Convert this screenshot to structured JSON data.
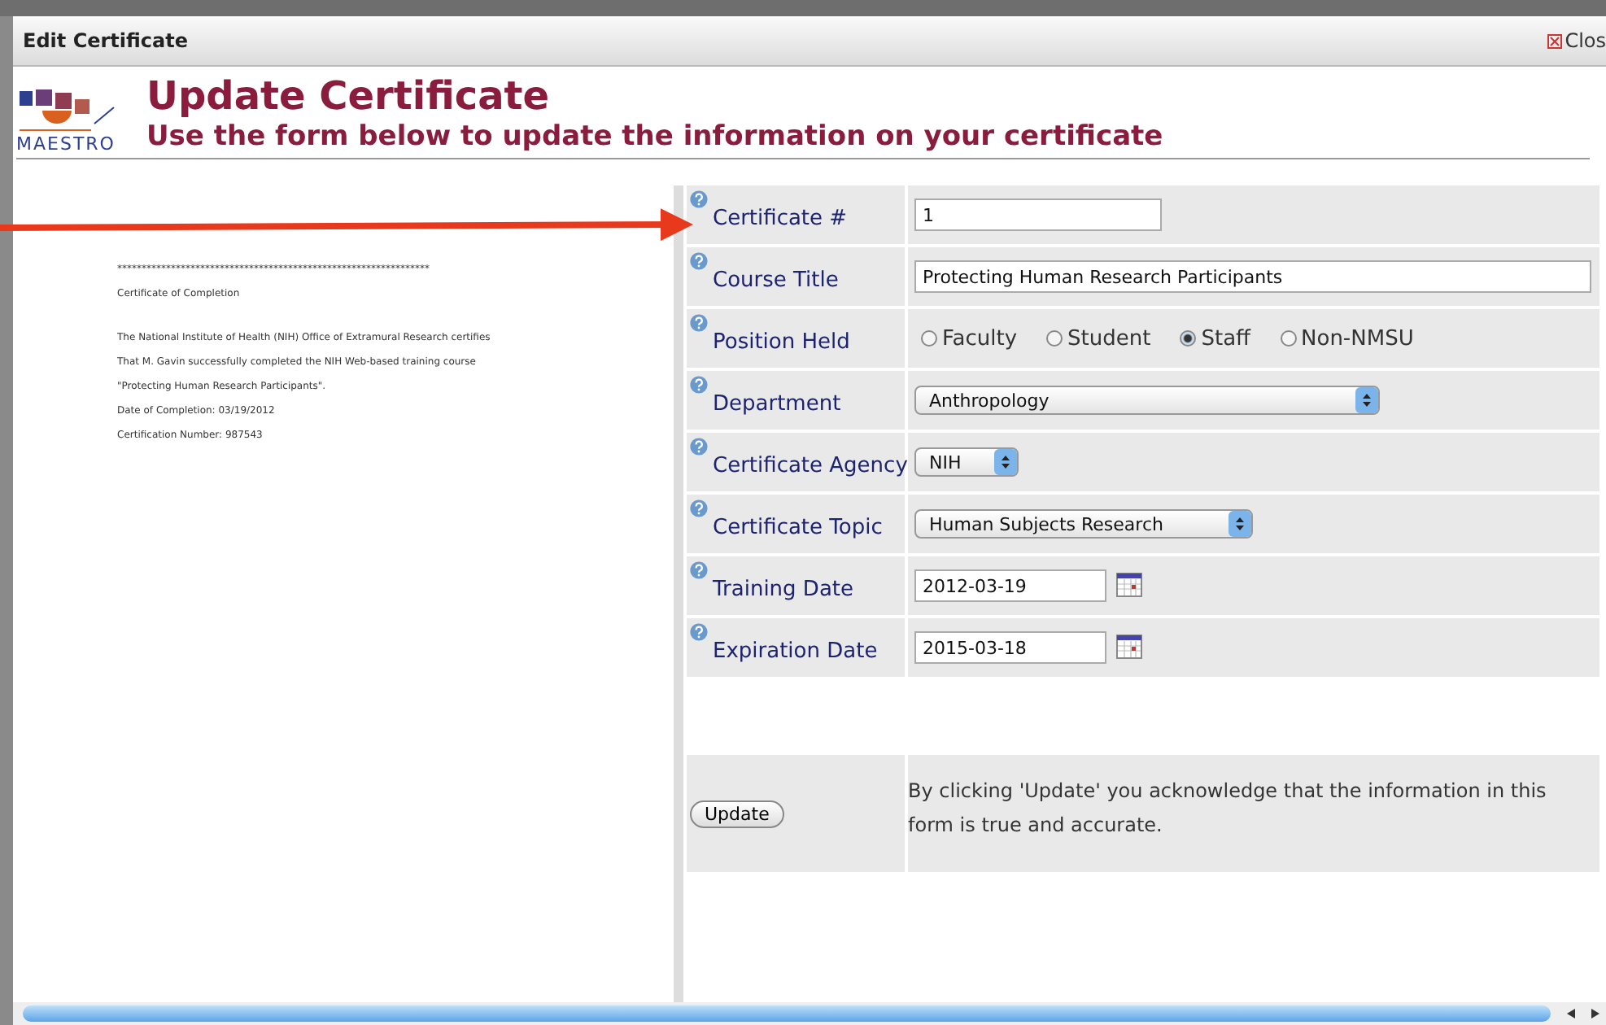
{
  "window": {
    "title": "Edit Certificate",
    "close": "Clos"
  },
  "header": {
    "logo": "MAESTRO",
    "title": "Update Certificate",
    "subtitle": "Use the form below to update the information on your certificate"
  },
  "document": {
    "lines": [
      "****************************************************************",
      "Certificate of Completion",
      "The National Institute of Health (NIH) Office of Extramural Research certifies",
      "That M. Gavin successfully completed the NIH Web-based training course",
      "\"Protecting Human Research Participants\".",
      "Date of Completion:  03/19/2012",
      "Certification Number: 987543"
    ]
  },
  "form": {
    "fields": [
      {
        "kind": "text",
        "label": "Certificate #",
        "value": "1"
      },
      {
        "kind": "text",
        "label": "Course Title",
        "value": "Protecting Human Research Participants"
      },
      {
        "kind": "radio",
        "label": "Position Held",
        "options": [
          {
            "label": "Faculty",
            "selected": false
          },
          {
            "label": "Student",
            "selected": false
          },
          {
            "label": "Staff",
            "selected": true
          },
          {
            "label": "Non-NMSU",
            "selected": false
          }
        ]
      },
      {
        "kind": "select",
        "label": "Department",
        "value": "Anthropology"
      },
      {
        "kind": "select",
        "label": "Certificate Agency",
        "value": "NIH"
      },
      {
        "kind": "select",
        "label": "Certificate Topic",
        "value": "Human Subjects Research"
      },
      {
        "kind": "date",
        "label": "Training Date",
        "value": "2012-03-19"
      },
      {
        "kind": "date",
        "label": "Expiration Date",
        "value": "2015-03-18"
      }
    ],
    "submit": {
      "label": "Update",
      "note": "By clicking 'Update' you acknowledge that the information in this form is true and accurate."
    }
  }
}
